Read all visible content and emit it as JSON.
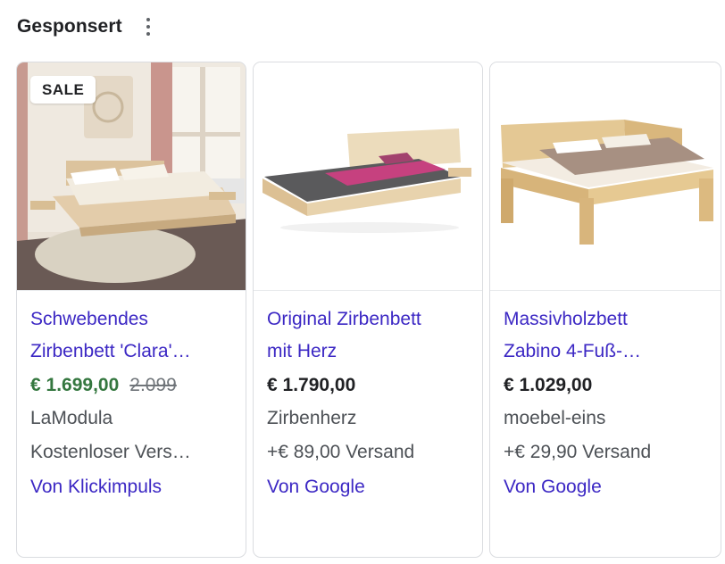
{
  "header": {
    "title": "Gesponsert",
    "menu_icon": "more-vert-icon"
  },
  "products": [
    {
      "badge": "SALE",
      "title_line1": "Schwebendes",
      "title_line2": "Zirbenbett 'Clara'…",
      "price": "€ 1.699,00",
      "old_price": "2.099",
      "merchant": "LaModula",
      "shipping": "Kostenloser Vers…",
      "by": "Von Klickimpuls",
      "price_color": "#34773f"
    },
    {
      "title_line1": "Original Zirbenbett",
      "title_line2": "mit Herz",
      "price": "€ 1.790,00",
      "merchant": "Zirbenherz",
      "shipping": "+€ 89,00 Versand",
      "by": "Von Google"
    },
    {
      "title_line1": "Massivholzbett",
      "title_line2": "Zabino 4-Fuß-…",
      "price": "€ 1.029,00",
      "merchant": "moebel-eins",
      "shipping": "+€ 29,90 Versand",
      "by": "Von Google"
    }
  ],
  "colors": {
    "link": "#3c28c4",
    "sale_price": "#34773f",
    "text": "#202124",
    "secondary": "#4d5156"
  }
}
